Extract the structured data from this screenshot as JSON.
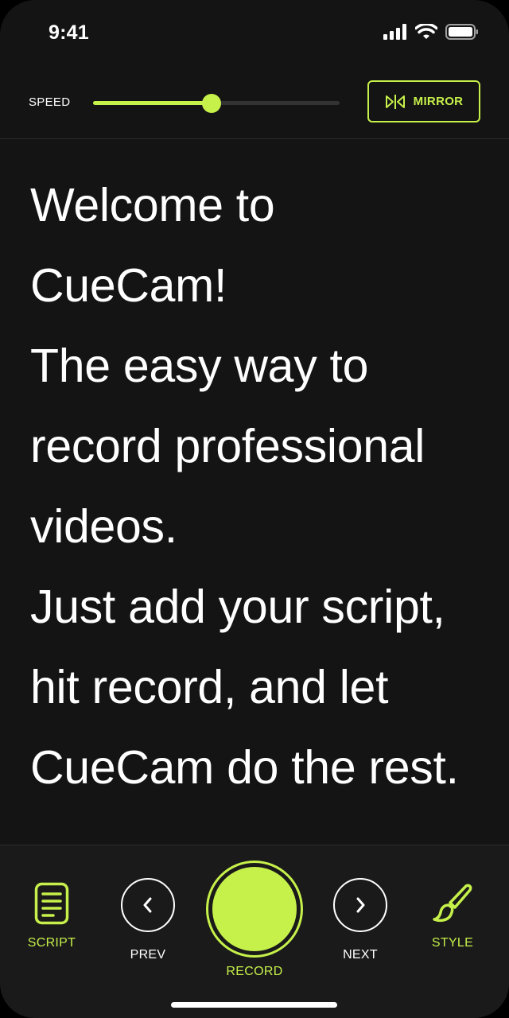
{
  "status_bar": {
    "time": "9:41",
    "icons": [
      "cellular-signal-icon",
      "wifi-icon",
      "battery-icon"
    ]
  },
  "controls": {
    "speed_label": "SPEED",
    "speed_value": 0.48,
    "mirror_label": "MIRROR",
    "mirror_icon": "mirror-flip-icon"
  },
  "script": {
    "lines": [
      "Welcome to",
      "CueCam!",
      "The easy way to",
      "record professional",
      "videos.",
      "Just add your script,",
      "hit record, and let",
      "CueCam do the rest."
    ]
  },
  "bottom_bar": {
    "script_label": "SCRIPT",
    "prev_label": "PREV",
    "record_label": "RECORD",
    "next_label": "NEXT",
    "style_label": "STYLE",
    "icons": [
      "document-icon",
      "chevron-left-icon",
      "record-icon",
      "chevron-right-icon",
      "brush-icon"
    ]
  },
  "colors": {
    "accent": "#c6f04a",
    "background": "#141414",
    "bottom_bar": "#1a1a1a",
    "text": "#ffffff"
  }
}
